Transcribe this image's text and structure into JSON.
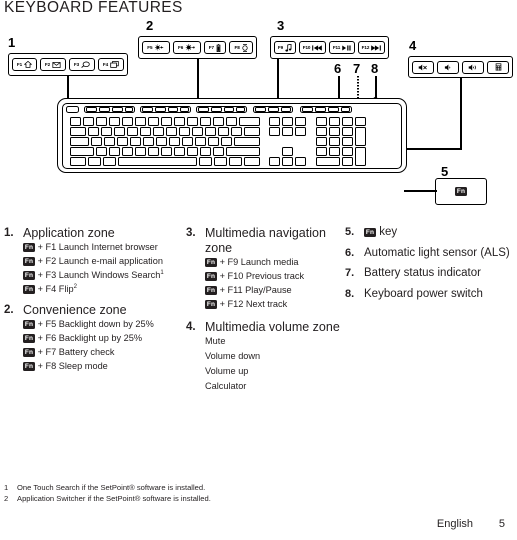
{
  "document": {
    "title": "KEYBOARD FEATURES"
  },
  "diagram": {
    "callouts": [
      {
        "id": "1",
        "label": "1"
      },
      {
        "id": "2",
        "label": "2"
      },
      {
        "id": "3",
        "label": "3"
      },
      {
        "id": "4",
        "label": "4"
      },
      {
        "id": "5",
        "label": "5"
      },
      {
        "id": "6",
        "label": "6"
      },
      {
        "id": "7",
        "label": "7"
      },
      {
        "id": "8",
        "label": "8"
      }
    ],
    "zone1_keys": [
      {
        "key": "F1",
        "icon": "home-icon"
      },
      {
        "key": "F2",
        "icon": "envelope-icon"
      },
      {
        "key": "F3",
        "icon": "magnifier-icon"
      },
      {
        "key": "F4",
        "icon": "windows-flip-icon"
      }
    ],
    "zone2_keys": [
      {
        "key": "F5",
        "icon": "backlight-down-icon"
      },
      {
        "key": "F6",
        "icon": "backlight-up-icon"
      },
      {
        "key": "F7",
        "icon": "battery-icon"
      },
      {
        "key": "F8",
        "icon": "sleep-moon-icon"
      }
    ],
    "zone3_keys": [
      {
        "key": "F9",
        "icon": "music-note-icon"
      },
      {
        "key": "F10",
        "icon": "previous-track-icon"
      },
      {
        "key": "F11",
        "icon": "play-pause-icon"
      },
      {
        "key": "F12",
        "icon": "next-track-icon"
      }
    ],
    "zone4_keys": [
      {
        "key": "",
        "icon": "mute-icon"
      },
      {
        "key": "",
        "icon": "volume-down-icon"
      },
      {
        "key": "",
        "icon": "volume-up-icon"
      },
      {
        "key": "",
        "icon": "calculator-icon"
      }
    ],
    "zone5_key": {
      "key": "Fn",
      "icon": "fn-key-icon"
    },
    "keyboard_image_name": "keyboard-top-view"
  },
  "sections": [
    {
      "number": "1.",
      "title": "Application zone",
      "items": [
        {
          "modifier": "Fn",
          "text": "+ F1 Launch Internet browser"
        },
        {
          "modifier": "Fn",
          "text": "+ F2 Launch e-mail application"
        },
        {
          "modifier": "Fn",
          "text": "+ F3 Launch Windows Search",
          "footnote": "1"
        },
        {
          "modifier": "Fn",
          "text": "+ F4 Flip",
          "footnote": "2"
        }
      ]
    },
    {
      "number": "2.",
      "title": "Convenience zone",
      "items": [
        {
          "modifier": "Fn",
          "text": "+ F5 Backlight down by 25%"
        },
        {
          "modifier": "Fn",
          "text": "+ F6 Backlight up by 25%"
        },
        {
          "modifier": "Fn",
          "text": "+ F7 Battery check"
        },
        {
          "modifier": "Fn",
          "text": "+ F8 Sleep mode"
        }
      ]
    },
    {
      "number": "3.",
      "title": "Multimedia navigation zone",
      "items": [
        {
          "modifier": "Fn",
          "text": "+ F9 Launch media"
        },
        {
          "modifier": "Fn",
          "text": "+ F10 Previous track"
        },
        {
          "modifier": "Fn",
          "text": "+ F11 Play/Pause"
        },
        {
          "modifier": "Fn",
          "text": "+ F12 Next track"
        }
      ]
    },
    {
      "number": "4.",
      "title": "Multimedia volume zone",
      "items": [
        {
          "modifier": "",
          "text": "Mute"
        },
        {
          "modifier": "",
          "text": "Volume down"
        },
        {
          "modifier": "",
          "text": "Volume up"
        },
        {
          "modifier": "",
          "text": "Calculator"
        }
      ]
    }
  ],
  "right_items": [
    {
      "number": "5.",
      "prefix_key": "Fn",
      "text": "key"
    },
    {
      "number": "6.",
      "prefix_key": "",
      "text": "Automatic light sensor (ALS)"
    },
    {
      "number": "7.",
      "prefix_key": "",
      "text": "Battery status indicator"
    },
    {
      "number": "8.",
      "prefix_key": "",
      "text": "Keyboard power switch"
    }
  ],
  "footnotes": [
    {
      "num": "1",
      "text": "One Touch Search if the SetPoint® software is installed."
    },
    {
      "num": "2",
      "text": "Application Switcher if the SetPoint® software is installed."
    }
  ],
  "footer": {
    "language": "English",
    "page": "5"
  },
  "colors": {
    "ink": "#231f20",
    "line": "#000000",
    "fn_chip_bg": "#231f20",
    "paper": "#ffffff"
  }
}
